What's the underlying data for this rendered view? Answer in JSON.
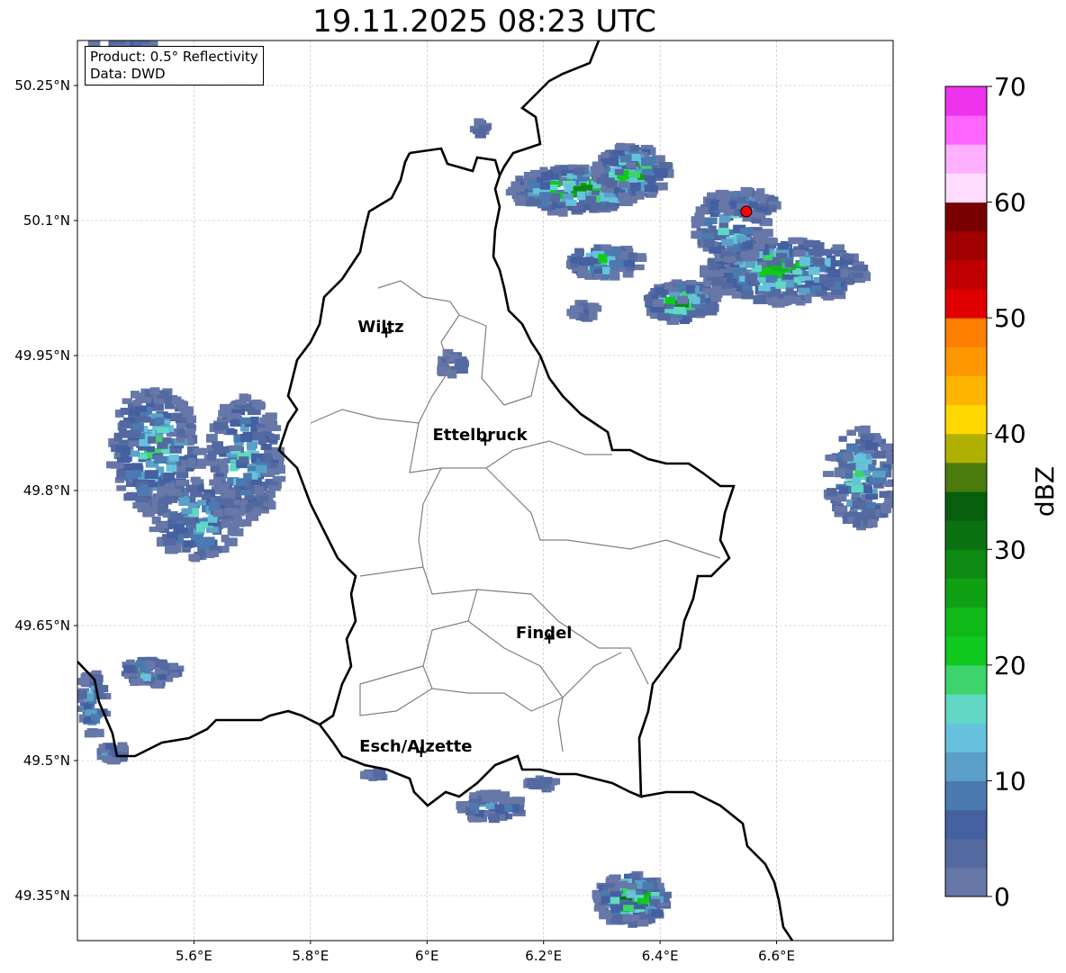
{
  "title": "19.11.2025 08:23 UTC",
  "info_box": {
    "product": "Product: 0.5° Reflectivity",
    "data": "Data: DWD"
  },
  "map": {
    "extent": {
      "lon": [
        5.4,
        6.8
      ],
      "lat": [
        49.3,
        50.3
      ]
    },
    "lon_ticks": [
      {
        "v": 5.6,
        "label": "5.6°E"
      },
      {
        "v": 5.8,
        "label": "5.8°E"
      },
      {
        "v": 6.0,
        "label": "6°E"
      },
      {
        "v": 6.2,
        "label": "6.2°E"
      },
      {
        "v": 6.4,
        "label": "6.4°E"
      },
      {
        "v": 6.6,
        "label": "6.6°E"
      }
    ],
    "lat_ticks": [
      {
        "v": 50.25,
        "label": "50.25°N"
      },
      {
        "v": 50.1,
        "label": "50.1°N"
      },
      {
        "v": 49.95,
        "label": "49.95°N"
      },
      {
        "v": 49.8,
        "label": "49.8°N"
      },
      {
        "v": 49.65,
        "label": "49.65°N"
      },
      {
        "v": 49.5,
        "label": "49.5°N"
      },
      {
        "v": 49.35,
        "label": "49.35°N"
      }
    ],
    "grid": true,
    "cities": [
      {
        "name": "Wiltz",
        "lon": 5.93,
        "lat": 49.966
      },
      {
        "name": "Ettelbruck",
        "lon": 6.1,
        "lat": 49.846
      },
      {
        "name": "Findel",
        "lon": 6.21,
        "lat": 49.626
      },
      {
        "name": "Esch/Alzette",
        "lon": 5.99,
        "lat": 49.5
      }
    ],
    "radar_site": {
      "lon": 6.548,
      "lat": 50.11,
      "color": "#ff0000"
    }
  },
  "colorbar": {
    "label": "dBZ",
    "min": 0,
    "max": 70,
    "step": 2.5,
    "ticks": [
      "0",
      "10",
      "20",
      "30",
      "40",
      "50",
      "60",
      "70"
    ],
    "colors": [
      "#6677a8",
      "#5469a0",
      "#4460a0",
      "#4a7ab0",
      "#5aa0c8",
      "#66c2dc",
      "#60d8c4",
      "#3dd46e",
      "#10c81e",
      "#10b81a",
      "#10a014",
      "#0e8a12",
      "#0a7010",
      "#075e0c",
      "#4a7a0c",
      "#b0b000",
      "#ffd800",
      "#ffb400",
      "#ff9800",
      "#ff7f00",
      "#e00000",
      "#c00000",
      "#a00000",
      "#7a0000",
      "#ffddff",
      "#ffb0ff",
      "#ff66ff",
      "#ee33ee"
    ]
  }
}
